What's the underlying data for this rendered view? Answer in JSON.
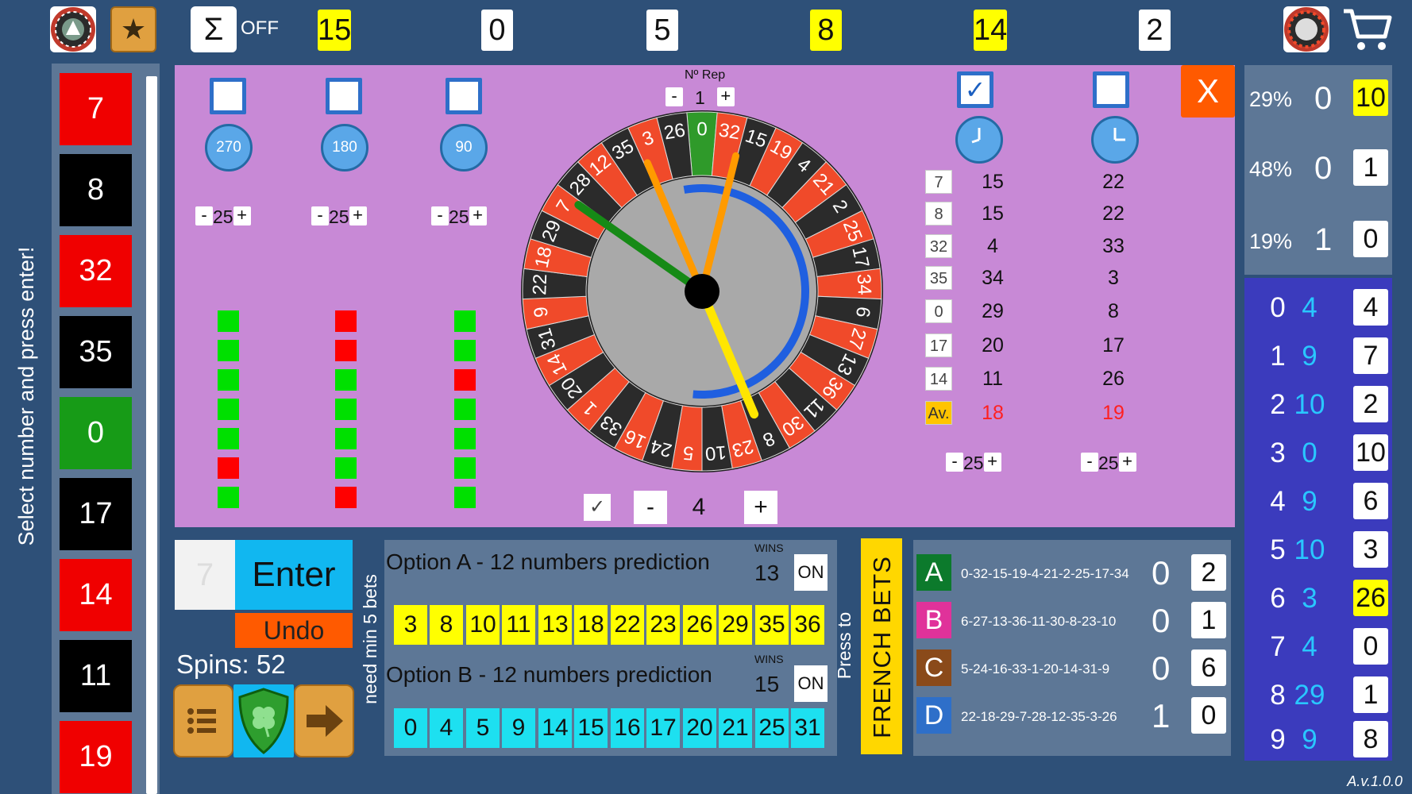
{
  "top": {
    "sum_label": "OFF",
    "numbers": [
      "15",
      "0",
      "5",
      "8",
      "14",
      "2"
    ]
  },
  "left": {
    "instruction": "Select number and press enter!",
    "history": [
      {
        "n": "7",
        "c": "red"
      },
      {
        "n": "8",
        "c": "black"
      },
      {
        "n": "32",
        "c": "red"
      },
      {
        "n": "35",
        "c": "black"
      },
      {
        "n": "0",
        "c": "green"
      },
      {
        "n": "17",
        "c": "black"
      },
      {
        "n": "14",
        "c": "red"
      },
      {
        "n": "11",
        "c": "black"
      },
      {
        "n": "19",
        "c": "red"
      }
    ]
  },
  "panel": {
    "dials": [
      "270",
      "180",
      "90"
    ],
    "steppers": [
      "25",
      "25",
      "25",
      "25",
      "25"
    ],
    "rep_label": "Nº Rep",
    "rep_value": "1",
    "rep_minus": "-",
    "rep_plus": "+",
    "minus": "-",
    "plus": "+",
    "bottom_value": "4",
    "table_nums": [
      "7",
      "8",
      "32",
      "35",
      "0",
      "17",
      "14"
    ],
    "col1": [
      "15",
      "15",
      "4",
      "34",
      "29",
      "20",
      "11"
    ],
    "col2": [
      "22",
      "22",
      "33",
      "3",
      "8",
      "17",
      "26"
    ],
    "av_label": "Av.",
    "av1": "18",
    "av2": "19",
    "close": "X"
  },
  "right_stats": [
    {
      "pct": "29%",
      "v": "0",
      "b": "10"
    },
    {
      "pct": "48%",
      "v": "0",
      "b": "1"
    },
    {
      "pct": "19%",
      "v": "1",
      "b": "0"
    }
  ],
  "right_list": [
    {
      "d": "0",
      "c": "4",
      "b": "4"
    },
    {
      "d": "1",
      "c": "9",
      "b": "7"
    },
    {
      "d": "2",
      "c": "10",
      "b": "2"
    },
    {
      "d": "3",
      "c": "0",
      "b": "10"
    },
    {
      "d": "4",
      "c": "9",
      "b": "6"
    },
    {
      "d": "5",
      "c": "10",
      "b": "3"
    },
    {
      "d": "6",
      "c": "3",
      "b": "26"
    },
    {
      "d": "7",
      "c": "4",
      "b": "0"
    },
    {
      "d": "8",
      "c": "29",
      "b": "1"
    },
    {
      "d": "9",
      "c": "9",
      "b": "8"
    }
  ],
  "controls": {
    "input_value": "7",
    "enter": "Enter",
    "undo": "Undo",
    "spins": "Spins: 52",
    "need_min": "need min 5 bets"
  },
  "options": {
    "a_title": "Option A - 12 numbers prediction",
    "a_wins_label": "WINS",
    "a_wins": "13",
    "a_on": "ON",
    "a_numbers": [
      "3",
      "8",
      "10",
      "11",
      "13",
      "18",
      "22",
      "23",
      "26",
      "29",
      "35",
      "36"
    ],
    "b_title": "Option B - 12 numbers prediction",
    "b_wins_label": "WINS",
    "b_wins": "15",
    "b_on": "ON",
    "b_numbers": [
      "0",
      "4",
      "5",
      "9",
      "14",
      "15",
      "16",
      "17",
      "20",
      "21",
      "25",
      "31"
    ]
  },
  "french": {
    "press_to": "Press to",
    "label": "FRENCH BETS",
    "rows": [
      {
        "l": "A",
        "seq": "0-32-15-19-4-21-2-25-17-34",
        "v": "0",
        "b": "2"
      },
      {
        "l": "B",
        "seq": "6-27-13-36-11-30-8-23-10",
        "v": "0",
        "b": "1"
      },
      {
        "l": "C",
        "seq": "5-24-16-33-1-20-14-31-9",
        "v": "0",
        "b": "6"
      },
      {
        "l": "D",
        "seq": "22-18-29-7-28-12-35-3-26",
        "v": "1",
        "b": "0"
      }
    ]
  },
  "wheel_numbers": [
    "0",
    "32",
    "15",
    "19",
    "4",
    "21",
    "2",
    "25",
    "17",
    "34",
    "6",
    "27",
    "13",
    "36",
    "11",
    "30",
    "8",
    "23",
    "10",
    "5",
    "24",
    "16",
    "33",
    "1",
    "20",
    "14",
    "31",
    "9",
    "22",
    "18",
    "29",
    "7",
    "28",
    "12",
    "35",
    "3",
    "26"
  ],
  "version": "A.v.1.0.0",
  "colors": {
    "bg": "#2e5078",
    "panel": "#c889d6",
    "wheel_red": "#f04a2a",
    "wheel_black": "#2b2b2b",
    "wheel_green": "#2f9a2a"
  }
}
